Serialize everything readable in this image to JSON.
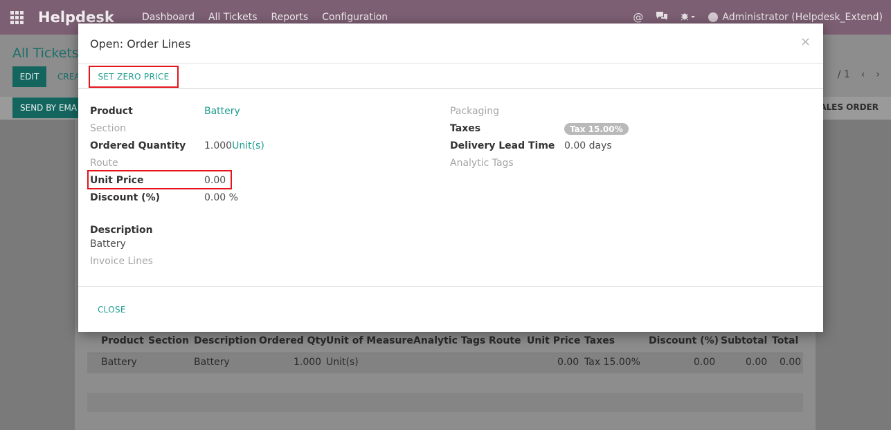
{
  "navbar": {
    "brand": "Helpdesk",
    "menu": [
      "Dashboard",
      "All Tickets",
      "Reports",
      "Configuration"
    ],
    "user": "Administrator (Helpdesk_Extend)"
  },
  "background": {
    "breadcrumb": "All Tickets",
    "edit_label": "EDIT",
    "create_label": "CREA",
    "pager": "/ 1",
    "send_label": "SEND BY EMA",
    "sales_order_label": "SALES ORDER",
    "table": {
      "headers": [
        "Product",
        "Section",
        "Description",
        "Ordered Qty",
        "Unit of Measure",
        "Analytic Tags",
        "Route",
        "Unit Price",
        "Taxes",
        "Discount (%)",
        "Subtotal",
        "Total"
      ],
      "row": {
        "product": "Battery",
        "description": "Battery",
        "qty": "1.000",
        "uom": "Unit(s)",
        "unit_price": "0.00",
        "taxes": "Tax 15.00%",
        "discount": "0.00",
        "subtotal": "0.00",
        "total": "0.00"
      }
    }
  },
  "modal": {
    "title": "Open: Order Lines",
    "close_symbol": "×",
    "set_zero_price": "SET ZERO PRICE",
    "left": {
      "product_label": "Product",
      "product_value": "Battery",
      "section_label": "Section",
      "ordered_qty_label": "Ordered Quantity",
      "ordered_qty_value": "1.000",
      "ordered_qty_unit": "Unit(s)",
      "route_label": "Route",
      "unit_price_label": "Unit Price",
      "unit_price_value": "0.00",
      "discount_label": "Discount (%)",
      "discount_value": "0.00 %"
    },
    "right": {
      "packaging_label": "Packaging",
      "taxes_label": "Taxes",
      "taxes_value": "Tax 15.00%",
      "lead_time_label": "Delivery Lead Time",
      "lead_time_value": "0.00 days",
      "analytic_tags_label": "Analytic Tags"
    },
    "description_label": "Description",
    "description_value": "Battery",
    "invoice_lines_label": "Invoice Lines",
    "close_label": "CLOSE"
  },
  "colors": {
    "navbar": "#7c5f73",
    "accent": "#1d9d8f",
    "highlight": "#e5141b",
    "dark_button": "#15655f"
  }
}
